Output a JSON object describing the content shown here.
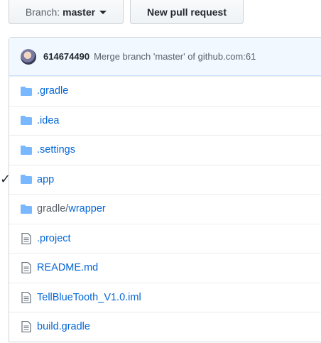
{
  "toolbar": {
    "branch_prefix": "Branch:",
    "branch_name": "master",
    "new_pr_label": "New pull request"
  },
  "commit": {
    "author": "614674490",
    "message": "Merge branch 'master' of github.com:61"
  },
  "files": [
    {
      "name": ".gradle",
      "type": "dir"
    },
    {
      "name": ".idea",
      "type": "dir"
    },
    {
      "name": ".settings",
      "type": "dir"
    },
    {
      "name": "app",
      "type": "dir"
    },
    {
      "name_prefix": "gradle/",
      "name": "wrapper",
      "type": "dir"
    },
    {
      "name": ".project",
      "type": "file"
    },
    {
      "name": "README.md",
      "type": "file"
    },
    {
      "name": "TellBlueTooth_V1.0.iml",
      "type": "file"
    },
    {
      "name": "build.gradle",
      "type": "file"
    }
  ],
  "marker": {
    "symbol": "✓"
  },
  "colors": {
    "link": "#0366d6",
    "icon": "#79b8ff"
  }
}
